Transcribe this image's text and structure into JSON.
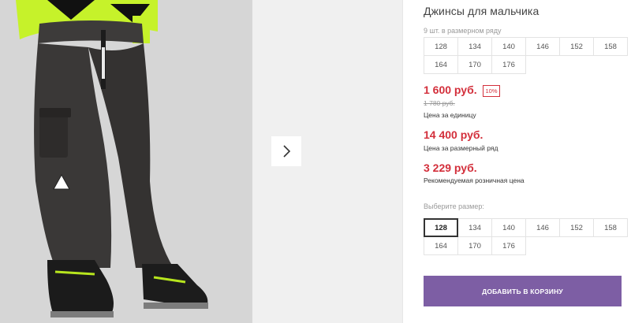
{
  "product": {
    "title": "Джинсы для мальчика"
  },
  "size_row": {
    "hint": "9 шт. в размерном ряду",
    "sizes": [
      "128",
      "134",
      "140",
      "146",
      "152",
      "158",
      "164",
      "170",
      "176"
    ]
  },
  "pricing": {
    "unit_price": "1 600 руб.",
    "discount_badge": "10%",
    "old_price": "1 780 руб.",
    "unit_label": "Цена за единицу",
    "row_price": "14 400 руб.",
    "row_label": "Цена за размерный ряд",
    "retail_price": "3 229 руб.",
    "retail_label": "Рекомендуемая розничная цена"
  },
  "size_select": {
    "label": "Выберите размер:",
    "sizes": [
      "128",
      "134",
      "140",
      "146",
      "152",
      "158",
      "164",
      "170",
      "176"
    ],
    "selected": "128"
  },
  "actions": {
    "add_to_cart": "ДОБАВИТЬ В КОРЗИНУ"
  },
  "icons": {
    "next": "chevron-right-icon"
  },
  "colors": {
    "accent": "#7d5ea4",
    "price": "#d32f3b"
  }
}
